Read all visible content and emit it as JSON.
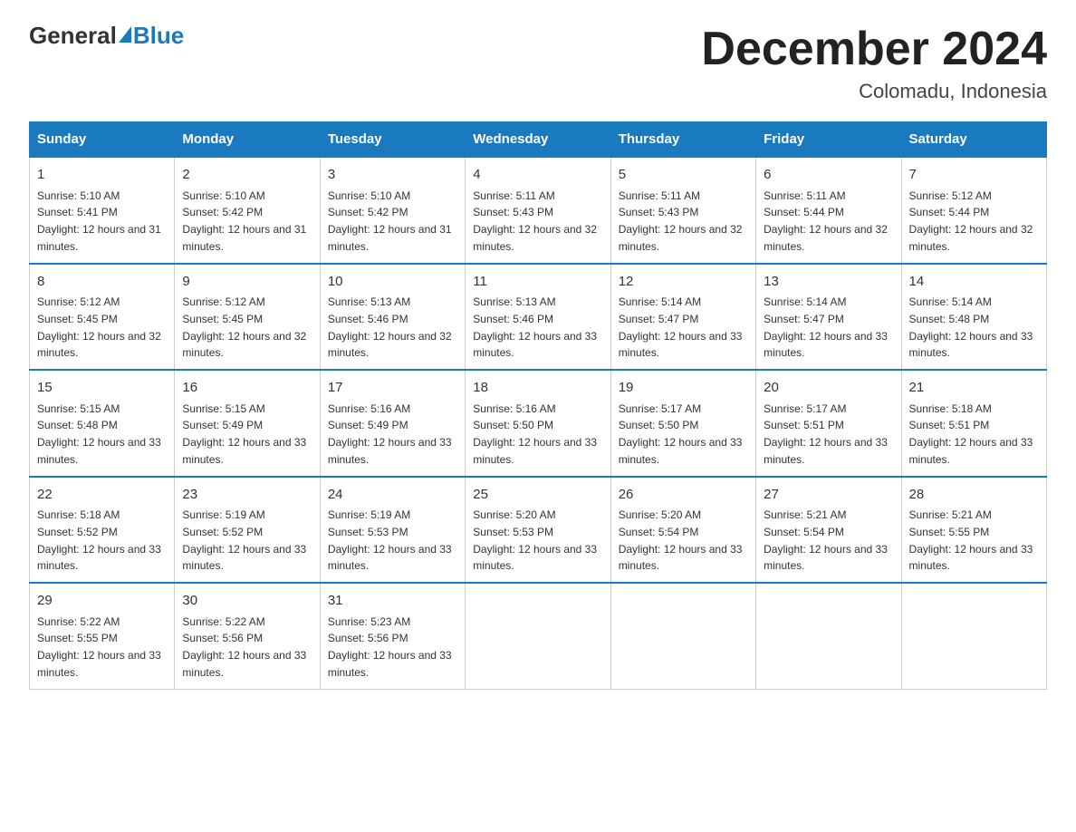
{
  "header": {
    "logo_general": "General",
    "logo_blue": "Blue",
    "title": "December 2024",
    "subtitle": "Colomadu, Indonesia"
  },
  "days_of_week": [
    "Sunday",
    "Monday",
    "Tuesday",
    "Wednesday",
    "Thursday",
    "Friday",
    "Saturday"
  ],
  "weeks": [
    [
      {
        "day": "1",
        "sunrise": "5:10 AM",
        "sunset": "5:41 PM",
        "daylight": "12 hours and 31 minutes."
      },
      {
        "day": "2",
        "sunrise": "5:10 AM",
        "sunset": "5:42 PM",
        "daylight": "12 hours and 31 minutes."
      },
      {
        "day": "3",
        "sunrise": "5:10 AM",
        "sunset": "5:42 PM",
        "daylight": "12 hours and 31 minutes."
      },
      {
        "day": "4",
        "sunrise": "5:11 AM",
        "sunset": "5:43 PM",
        "daylight": "12 hours and 32 minutes."
      },
      {
        "day": "5",
        "sunrise": "5:11 AM",
        "sunset": "5:43 PM",
        "daylight": "12 hours and 32 minutes."
      },
      {
        "day": "6",
        "sunrise": "5:11 AM",
        "sunset": "5:44 PM",
        "daylight": "12 hours and 32 minutes."
      },
      {
        "day": "7",
        "sunrise": "5:12 AM",
        "sunset": "5:44 PM",
        "daylight": "12 hours and 32 minutes."
      }
    ],
    [
      {
        "day": "8",
        "sunrise": "5:12 AM",
        "sunset": "5:45 PM",
        "daylight": "12 hours and 32 minutes."
      },
      {
        "day": "9",
        "sunrise": "5:12 AM",
        "sunset": "5:45 PM",
        "daylight": "12 hours and 32 minutes."
      },
      {
        "day": "10",
        "sunrise": "5:13 AM",
        "sunset": "5:46 PM",
        "daylight": "12 hours and 32 minutes."
      },
      {
        "day": "11",
        "sunrise": "5:13 AM",
        "sunset": "5:46 PM",
        "daylight": "12 hours and 33 minutes."
      },
      {
        "day": "12",
        "sunrise": "5:14 AM",
        "sunset": "5:47 PM",
        "daylight": "12 hours and 33 minutes."
      },
      {
        "day": "13",
        "sunrise": "5:14 AM",
        "sunset": "5:47 PM",
        "daylight": "12 hours and 33 minutes."
      },
      {
        "day": "14",
        "sunrise": "5:14 AM",
        "sunset": "5:48 PM",
        "daylight": "12 hours and 33 minutes."
      }
    ],
    [
      {
        "day": "15",
        "sunrise": "5:15 AM",
        "sunset": "5:48 PM",
        "daylight": "12 hours and 33 minutes."
      },
      {
        "day": "16",
        "sunrise": "5:15 AM",
        "sunset": "5:49 PM",
        "daylight": "12 hours and 33 minutes."
      },
      {
        "day": "17",
        "sunrise": "5:16 AM",
        "sunset": "5:49 PM",
        "daylight": "12 hours and 33 minutes."
      },
      {
        "day": "18",
        "sunrise": "5:16 AM",
        "sunset": "5:50 PM",
        "daylight": "12 hours and 33 minutes."
      },
      {
        "day": "19",
        "sunrise": "5:17 AM",
        "sunset": "5:50 PM",
        "daylight": "12 hours and 33 minutes."
      },
      {
        "day": "20",
        "sunrise": "5:17 AM",
        "sunset": "5:51 PM",
        "daylight": "12 hours and 33 minutes."
      },
      {
        "day": "21",
        "sunrise": "5:18 AM",
        "sunset": "5:51 PM",
        "daylight": "12 hours and 33 minutes."
      }
    ],
    [
      {
        "day": "22",
        "sunrise": "5:18 AM",
        "sunset": "5:52 PM",
        "daylight": "12 hours and 33 minutes."
      },
      {
        "day": "23",
        "sunrise": "5:19 AM",
        "sunset": "5:52 PM",
        "daylight": "12 hours and 33 minutes."
      },
      {
        "day": "24",
        "sunrise": "5:19 AM",
        "sunset": "5:53 PM",
        "daylight": "12 hours and 33 minutes."
      },
      {
        "day": "25",
        "sunrise": "5:20 AM",
        "sunset": "5:53 PM",
        "daylight": "12 hours and 33 minutes."
      },
      {
        "day": "26",
        "sunrise": "5:20 AM",
        "sunset": "5:54 PM",
        "daylight": "12 hours and 33 minutes."
      },
      {
        "day": "27",
        "sunrise": "5:21 AM",
        "sunset": "5:54 PM",
        "daylight": "12 hours and 33 minutes."
      },
      {
        "day": "28",
        "sunrise": "5:21 AM",
        "sunset": "5:55 PM",
        "daylight": "12 hours and 33 minutes."
      }
    ],
    [
      {
        "day": "29",
        "sunrise": "5:22 AM",
        "sunset": "5:55 PM",
        "daylight": "12 hours and 33 minutes."
      },
      {
        "day": "30",
        "sunrise": "5:22 AM",
        "sunset": "5:56 PM",
        "daylight": "12 hours and 33 minutes."
      },
      {
        "day": "31",
        "sunrise": "5:23 AM",
        "sunset": "5:56 PM",
        "daylight": "12 hours and 33 minutes."
      },
      null,
      null,
      null,
      null
    ]
  ]
}
